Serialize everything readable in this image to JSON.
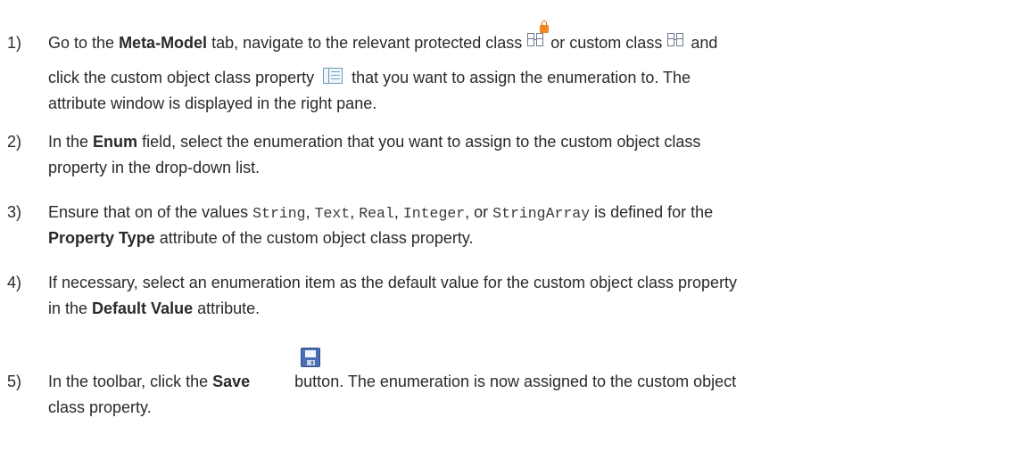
{
  "steps": [
    {
      "number": "1)",
      "line1": {
        "a": "Go to the ",
        "b": "Meta-Model",
        "c": " tab, navigate to the relevant protected class",
        "d": "or custom class",
        "e": "and"
      },
      "line2": {
        "a": "click the custom object class property",
        "b": "that you want to assign the enumeration to. The"
      },
      "line3": "attribute window is displayed in the right pane."
    },
    {
      "number": "2)",
      "line1": {
        "a": "In the ",
        "b": "Enum",
        "c": " field, select the enumeration that you want to assign to the custom object class"
      },
      "line2": "property in the drop-down list."
    },
    {
      "number": "3)",
      "line1": {
        "a": "Ensure that on of the values ",
        "v1": "String",
        "s1": ", ",
        "v2": "Text",
        "s2": ", ",
        "v3": "Real",
        "s3": ", ",
        "v4": "Integer",
        "s4": ", or ",
        "v5": "StringArray",
        "c": " is defined for the"
      },
      "line2": {
        "b": "Property Type",
        "c": " attribute of the custom object class property."
      }
    },
    {
      "number": "4)",
      "line1": "If necessary, select an enumeration item as the default value for the custom object class property",
      "line2": {
        "a": "in the ",
        "b": "Default Value",
        "c": " attribute."
      }
    },
    {
      "number": "5)",
      "line1": {
        "a": "In the toolbar, click the ",
        "b": "Save",
        "c": "button. The enumeration is now assigned to the custom object"
      },
      "line2": "class property."
    }
  ],
  "icons": {
    "protected_class": "protected-class-icon",
    "custom_class": "custom-class-icon",
    "property": "custom-object-class-property-icon",
    "save": "save-icon"
  }
}
